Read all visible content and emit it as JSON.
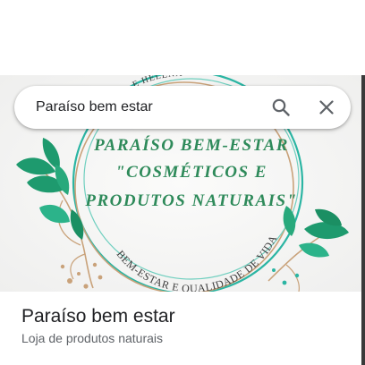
{
  "search": {
    "query": "Paraíso bem estar",
    "search_icon": "search-icon",
    "clear_icon": "close-icon"
  },
  "photo": {
    "arc_top_text": "E HELENA",
    "logo_line1": "PARAÍSO BEM-ESTAR",
    "logo_line2": "\"COSMÉTICOS E",
    "logo_line3": "PRODUTOS NATURAIS\"",
    "arc_bottom_text": "BEM-ESTAR E QUALIDADE DE VIDA"
  },
  "place": {
    "name": "Paraíso bem estar",
    "category": "Loja de produtos naturais"
  },
  "colors": {
    "logo_text": "#2e8a5a",
    "ring_teal": "#2bb5a3",
    "ring_gold": "#c9a27a",
    "leaf": "#1e9a6e",
    "title_text": "#202124",
    "subtitle_text": "#5f6368"
  }
}
